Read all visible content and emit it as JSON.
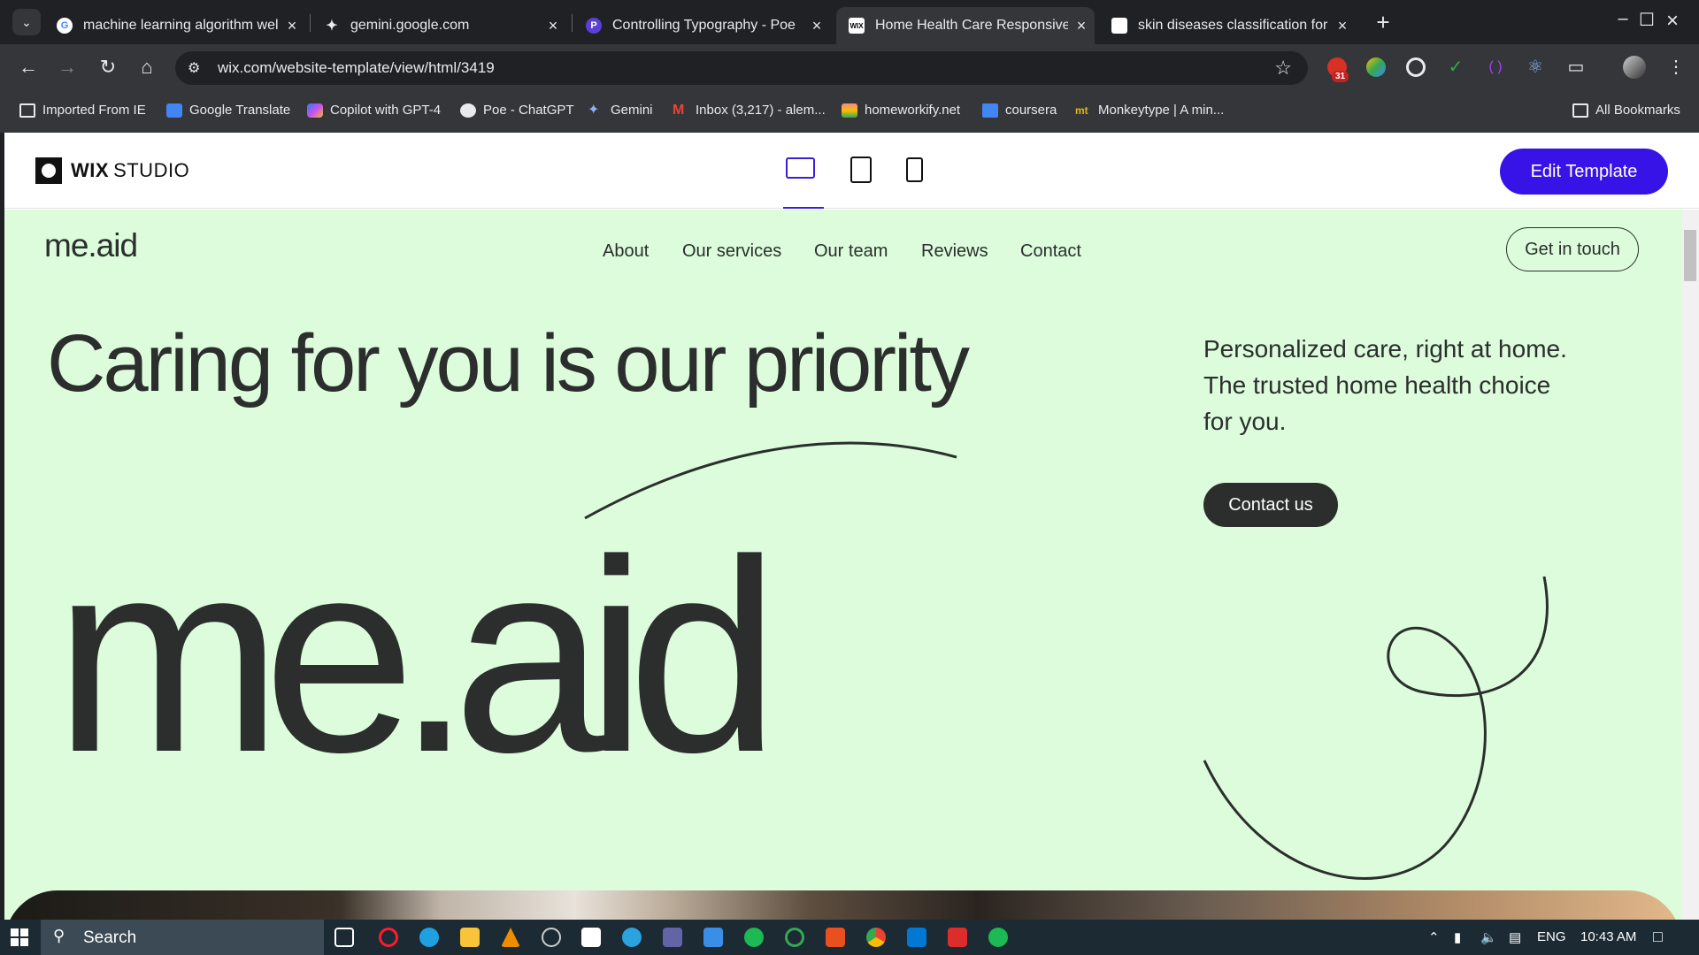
{
  "browser": {
    "tabs": [
      {
        "title": "machine learning algorithm wel",
        "favicon": "google-icon"
      },
      {
        "title": "gemini.google.com",
        "favicon": "gemini-icon"
      },
      {
        "title": "Controlling Typography - Poe",
        "favicon": "poe-icon"
      },
      {
        "title": "Home Health Care Responsive T",
        "favicon": "wix-icon",
        "active": true
      },
      {
        "title": "skin diseases classification for a",
        "favicon": "doc-icon"
      }
    ],
    "url": "wix.com/website-template/view/html/3419",
    "extension_badge": "31",
    "bookmarks": [
      "Imported From IE",
      "Google Translate",
      "Copilot with GPT-4",
      "Poe - ChatGPT",
      "Gemini",
      "Inbox (3,217) - alem...",
      "homeworkify.net",
      "coursera",
      "Monkeytype | A min...",
      "All Bookmarks"
    ]
  },
  "wix": {
    "logo_bold": "WIX",
    "logo_light": "STUDIO",
    "edit_button": "Edit Template"
  },
  "site": {
    "logo": "me.aid",
    "nav": [
      "About",
      "Our services",
      "Our team",
      "Reviews",
      "Contact"
    ],
    "cta": "Get in touch",
    "hero_title": "Caring for you is our priority",
    "hero_subtitle": "Personalized care, right at home. The trusted home health choice for you.",
    "contact_button": "Contact us",
    "big_logo": "me.aid",
    "colors": {
      "background": "#dcfcdb",
      "text": "#2b2e2d",
      "accent": "#3713e8"
    }
  },
  "taskbar": {
    "search": "Search",
    "language": "ENG",
    "time": "10:43 AM"
  }
}
